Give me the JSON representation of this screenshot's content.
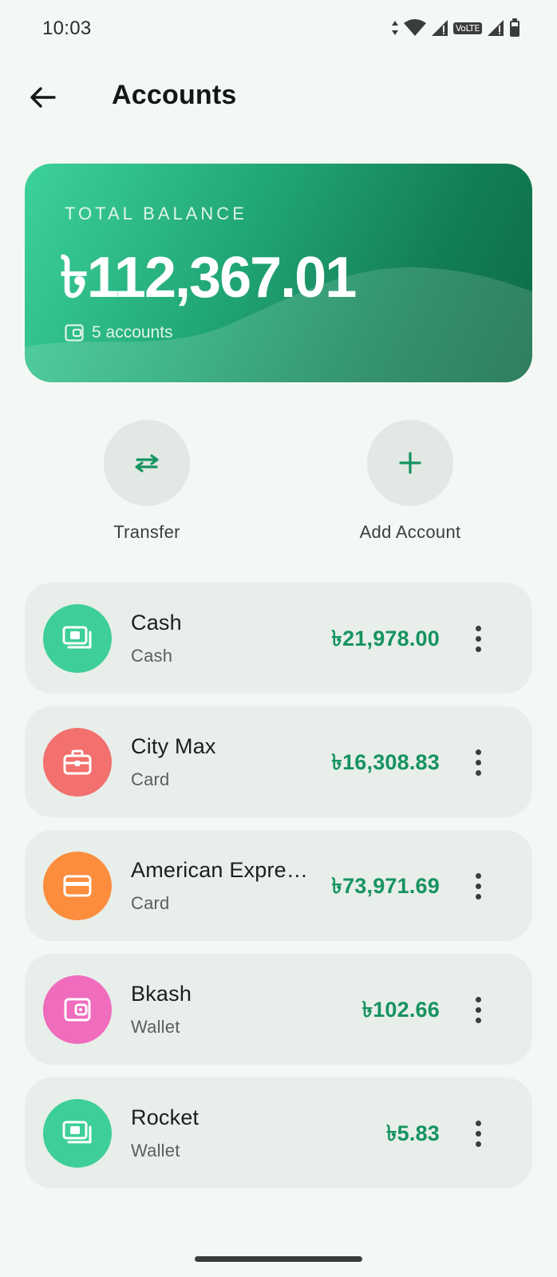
{
  "status_bar": {
    "time": "10:03",
    "volte": "VoLTE",
    "icons": [
      "data-arrows-icon",
      "wifi-icon",
      "signal-icon",
      "signal-icon",
      "battery-icon"
    ]
  },
  "header": {
    "back_icon": "arrow-left-icon",
    "title": "Accounts"
  },
  "balance_card": {
    "label": "TOTAL BALANCE",
    "amount": "৳112,367.01",
    "count_icon": "wallet-icon",
    "count_text": "5 accounts",
    "colors": {
      "start": "#3dd29a",
      "end": "#0d6a45"
    }
  },
  "actions": [
    {
      "label": "Transfer",
      "icon": "swap-arrows-icon"
    },
    {
      "label": "Add Account",
      "icon": "plus-icon"
    }
  ],
  "accounts": [
    {
      "name": "Cash",
      "type": "Cash",
      "balance": "৳21,978.00",
      "icon": "money-icon",
      "color": "#3dcf97"
    },
    {
      "name": "City Max",
      "type": "Card",
      "balance": "৳16,308.83",
      "icon": "briefcase-icon",
      "color": "#f2706d"
    },
    {
      "name": "American Express",
      "type": "Card",
      "balance": "৳73,971.69",
      "icon": "credit-card-icon",
      "color": "#fb8d3d"
    },
    {
      "name": "Bkash",
      "type": "Wallet",
      "balance": "৳102.66",
      "icon": "wallet-icon",
      "color": "#f06cbd"
    },
    {
      "name": "Rocket",
      "type": "Wallet",
      "balance": "৳5.83",
      "icon": "money-icon",
      "color": "#3dcf97"
    }
  ],
  "theme": {
    "accent": "#15935f",
    "background": "#f4f8f5",
    "card": "#e8eeea"
  }
}
